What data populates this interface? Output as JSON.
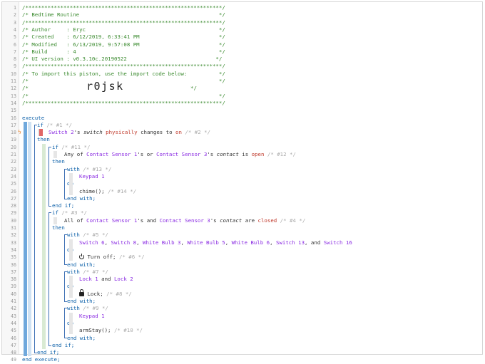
{
  "line_numbers": [
    "1",
    "2",
    "3",
    "4",
    "5",
    "6",
    "7",
    "8",
    "9",
    "10",
    "11",
    "12",
    "13",
    "14",
    "15",
    "16",
    "17",
    "18",
    "19",
    "20",
    "21",
    "22",
    "23",
    "24",
    "25",
    "26",
    "27",
    "28",
    "29",
    "30",
    "31",
    "32",
    "33",
    "34",
    "35",
    "36",
    "37",
    "38",
    "39",
    "40",
    "41",
    "42",
    "43",
    "44",
    "45",
    "46",
    "47",
    "48",
    "49"
  ],
  "header": {
    "stars": "/**************************************************************/",
    "title": "/* Bedtime Routine                                            */",
    "author": "/* Author     : Eryc                                          */",
    "created": "/* Created    : 6/12/2019, 6:33:41 PM                         */",
    "modified": "/* Modified   : 6/13/2019, 9:57:08 PM                         */",
    "build": "/* Build      : 4                                             */",
    "ui_version": "/* UI version : v0.3.10c.20190522                            */",
    "import_note": "/* To import this piston, use the import code below:          */",
    "blank1": "/*                                                            */",
    "import_code_prefix": "/*",
    "import_code": "r0jsk",
    "import_code_suffix": "*/",
    "blank2": "/*                                                            */"
  },
  "code": {
    "execute": "execute",
    "if": "if",
    "then": "then",
    "do": "do",
    "with": "with",
    "end_with": "end with;",
    "end_if": "end if;",
    "end_execute": "end execute;",
    "c1": "/* #1 */",
    "c2": "/* #2 */",
    "c11": "/* #11 */",
    "c12": "/* #12 */",
    "c13": "/* #13 */",
    "c14": "/* #14 */",
    "c3": "/* #3 */",
    "c4": "/* #4 */",
    "c5": "/* #5 */",
    "c6": "/* #6 */",
    "c7": "/* #7 */",
    "c8": "/* #8 */",
    "c9": "/* #9 */",
    "c10": "/* #10 */",
    "switch2": "Switch 2",
    "apos_s": "'s",
    "switch_attr": "switch",
    "physically": "physically",
    "changes_to": "changes to",
    "on": "on",
    "any_of": "Any of",
    "contact1": "Contact Sensor 1",
    "or": "or",
    "contact3": "Contact Sensor 3",
    "contact_attr": "contact",
    "is": "is",
    "open": "open",
    "keypad1": "Keypad 1",
    "chime": "chime();",
    "all_of": "All of",
    "and": "and",
    "are": "are",
    "closed": "closed",
    "sw6": "Switch 6",
    "sw8": "Switch 8",
    "wb3": "White Bulb 3",
    "wb5": "White Bulb 5",
    "wb6": "White Bulb 6",
    "sw13": "Switch 13",
    "sw16": "Switch 16",
    "comma": ",",
    "and_word": "and",
    "turn_off": "Turn off;",
    "lock1": "Lock 1",
    "lock2": "Lock 2",
    "lock": "Lock;",
    "arm_stay": "armStay();"
  }
}
